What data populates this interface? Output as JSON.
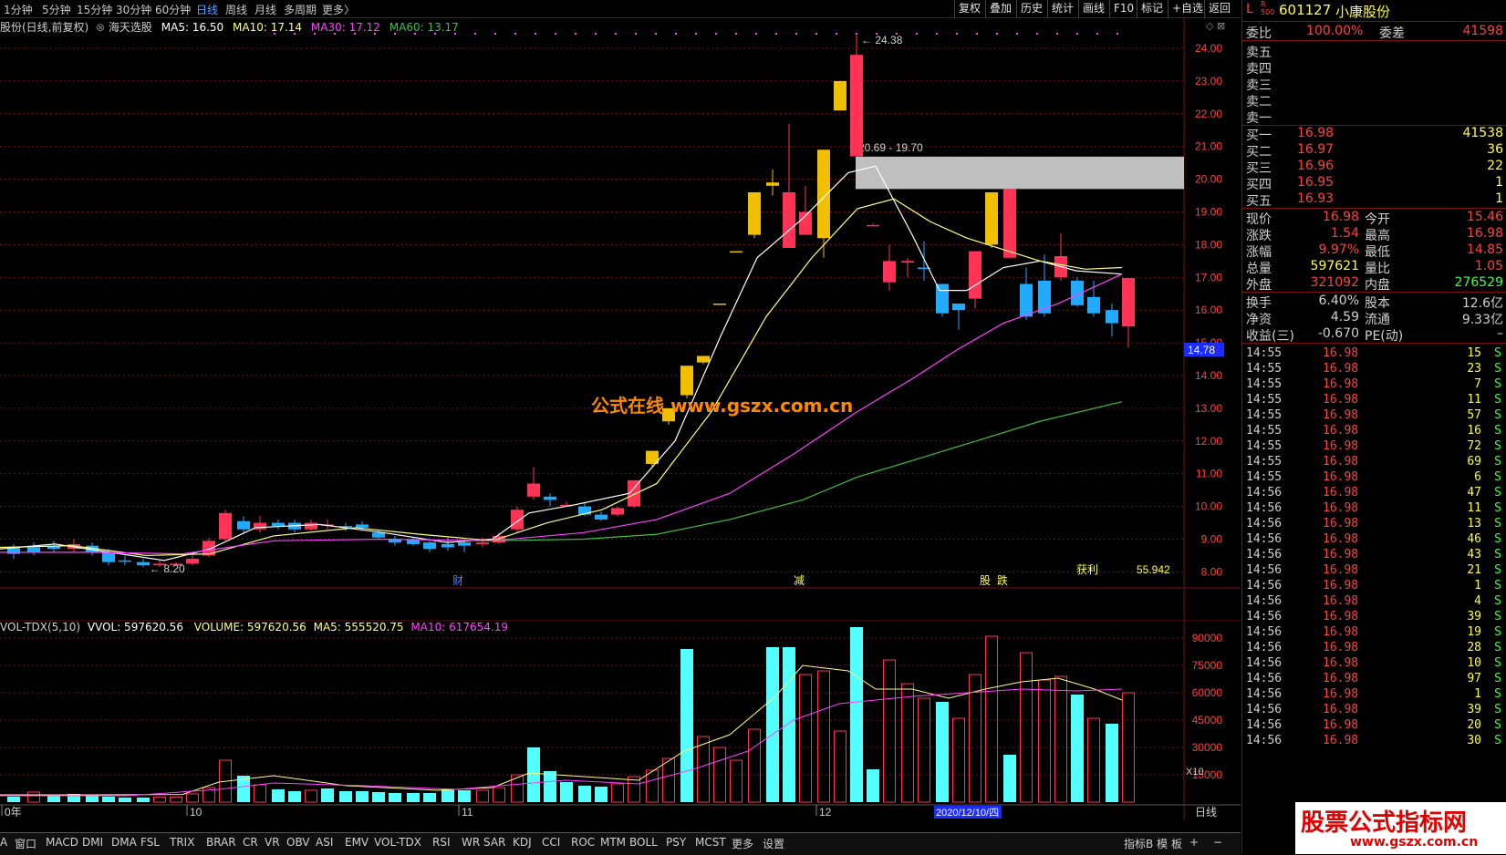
{
  "toolbar": {
    "timeframes": [
      "1分钟",
      "5分钟",
      "15分钟",
      "30分钟",
      "60分钟",
      "日线",
      "周线",
      "月线",
      "多周期",
      "更多〉"
    ],
    "active_timeframe": "日线",
    "buttons": [
      "复权",
      "叠加",
      "历史",
      "统计",
      "画线",
      "F10",
      "标记",
      "+自选",
      "返回"
    ]
  },
  "chart_header": {
    "title": "股份(日线,前复权)",
    "indicator": "海天选股",
    "ma5": "MA5: 16.50",
    "ma10": "MA10: 17.14",
    "ma30": "MA30: 17.12",
    "ma60": "MA60: 13.17"
  },
  "price_axis": [
    "24.00",
    "23.00",
    "22.00",
    "21.00",
    "20.00",
    "19.00",
    "18.00",
    "17.00",
    "16.00",
    "15.00",
    "14.00",
    "13.00",
    "12.00",
    "11.00",
    "10.00",
    "9.00",
    "8.00"
  ],
  "price_marker": "14.78",
  "annotations": {
    "high_label": "24.38",
    "low_label": "8.20",
    "zone_label": "20.69 - 19.70",
    "watermark": "公式在线  www.gszx.com.cn",
    "event1": "财",
    "event2": "减",
    "event3": "股",
    "event4": "跌",
    "profit_label": "获利",
    "profit_value": "55.942"
  },
  "volume_header": {
    "name": "VOL-TDX(5,10)",
    "vvol": "VVOL: 597620.56",
    "volume": "VOLUME: 597620.56",
    "ma5": "MA5: 555520.75",
    "ma10": "MA10: 617654.19"
  },
  "volume_axis": [
    "90000",
    "75000",
    "60000",
    "45000",
    "30000",
    "15000"
  ],
  "volume_unit": "X10",
  "date_axis": {
    "labels": [
      "0年",
      "10",
      "11",
      "12"
    ],
    "highlight": "2020/12/10/四",
    "right": "日线"
  },
  "indicator_tabs": [
    "A",
    "窗口",
    "MACD",
    "DMI",
    "DMA",
    "FSL",
    "TRIX",
    "BRAR",
    "CR",
    "VR",
    "OBV",
    "ASI",
    "EMV",
    "VOL-TDX",
    "RSI",
    "WR",
    "SAR",
    "KDJ",
    "CCI",
    "ROC",
    "MTM",
    "BOLL",
    "PSY",
    "MCST",
    "更多",
    "设置"
  ],
  "bottom_right": [
    "指标B",
    "模",
    "板",
    "+",
    "−"
  ],
  "quote": {
    "market": "L",
    "code": "601127",
    "name": "小康股份",
    "weibi_label": "委比",
    "weibi": "100.00%",
    "weicha_label": "委差",
    "weicha": "41598",
    "sell": [
      {
        "label": "卖五"
      },
      {
        "label": "卖四"
      },
      {
        "label": "卖三"
      },
      {
        "label": "卖二"
      },
      {
        "label": "卖一"
      }
    ],
    "buy": [
      {
        "label": "买一",
        "price": "16.98",
        "vol": "41538"
      },
      {
        "label": "买二",
        "price": "16.97",
        "vol": "36"
      },
      {
        "label": "买三",
        "price": "16.96",
        "vol": "22"
      },
      {
        "label": "买四",
        "price": "16.95",
        "vol": "1"
      },
      {
        "label": "买五",
        "price": "16.93",
        "vol": "1"
      }
    ],
    "stats": [
      {
        "l1": "现价",
        "v1": "16.98",
        "l2": "今开",
        "v2": "15.46"
      },
      {
        "l1": "涨跌",
        "v1": "1.54",
        "l2": "最高",
        "v2": "16.98"
      },
      {
        "l1": "涨幅",
        "v1": "9.97%",
        "l2": "最低",
        "v2": "14.85"
      },
      {
        "l1": "总量",
        "v1": "597621",
        "l2": "量比",
        "v2": "1.05"
      },
      {
        "l1": "外盘",
        "v1": "321092",
        "l2": "内盘",
        "v2": "276529"
      }
    ],
    "stats2": [
      {
        "l1": "换手",
        "v1": "6.40%",
        "l2": "股本",
        "v2": "12.6亿"
      },
      {
        "l1": "净资",
        "v1": "4.59",
        "l2": "流通",
        "v2": "9.33亿"
      },
      {
        "l1": "收益(三)",
        "v1": "-0.670",
        "l2": "PE(动)",
        "v2": "–"
      }
    ]
  },
  "ticks": [
    {
      "t": "14:55",
      "p": "16.98",
      "v": "15",
      "s": "S"
    },
    {
      "t": "14:55",
      "p": "16.98",
      "v": "23",
      "s": "S"
    },
    {
      "t": "14:55",
      "p": "16.98",
      "v": "7",
      "s": "S"
    },
    {
      "t": "14:55",
      "p": "16.98",
      "v": "11",
      "s": "S"
    },
    {
      "t": "14:55",
      "p": "16.98",
      "v": "57",
      "s": "S"
    },
    {
      "t": "14:55",
      "p": "16.98",
      "v": "16",
      "s": "S"
    },
    {
      "t": "14:55",
      "p": "16.98",
      "v": "72",
      "s": "S"
    },
    {
      "t": "14:55",
      "p": "16.98",
      "v": "69",
      "s": "S"
    },
    {
      "t": "14:55",
      "p": "16.98",
      "v": "6",
      "s": "S"
    },
    {
      "t": "14:56",
      "p": "16.98",
      "v": "47",
      "s": "S"
    },
    {
      "t": "14:56",
      "p": "16.98",
      "v": "11",
      "s": "S"
    },
    {
      "t": "14:56",
      "p": "16.98",
      "v": "13",
      "s": "S"
    },
    {
      "t": "14:56",
      "p": "16.98",
      "v": "46",
      "s": "S"
    },
    {
      "t": "14:56",
      "p": "16.98",
      "v": "43",
      "s": "S"
    },
    {
      "t": "14:56",
      "p": "16.98",
      "v": "21",
      "s": "S"
    },
    {
      "t": "14:56",
      "p": "16.98",
      "v": "1",
      "s": "S"
    },
    {
      "t": "14:56",
      "p": "16.98",
      "v": "4",
      "s": "S"
    },
    {
      "t": "14:56",
      "p": "16.98",
      "v": "39",
      "s": "S"
    },
    {
      "t": "14:56",
      "p": "16.98",
      "v": "19",
      "s": "S"
    },
    {
      "t": "14:56",
      "p": "16.98",
      "v": "28",
      "s": "S"
    },
    {
      "t": "14:56",
      "p": "16.98",
      "v": "10",
      "s": "S"
    },
    {
      "t": "14:56",
      "p": "16.98",
      "v": "97",
      "s": "S"
    },
    {
      "t": "14:56",
      "p": "16.98",
      "v": "1",
      "s": "S"
    },
    {
      "t": "14:56",
      "p": "16.98",
      "v": "39",
      "s": "S"
    },
    {
      "t": "14:56",
      "p": "16.98",
      "v": "20",
      "s": "S"
    },
    {
      "t": "14:56",
      "p": "16.98",
      "v": "30",
      "s": "S"
    }
  ],
  "logo": {
    "title": "股票公式指标网",
    "url": "www.gszx.com.cn"
  },
  "colors": {
    "up": "#ff3355",
    "down": "#54ffff",
    "ma5": "#ffffff",
    "ma10": "#ffff80",
    "ma30": "#ff40ff",
    "ma60": "#40c040",
    "grid": "#7a1010"
  }
}
